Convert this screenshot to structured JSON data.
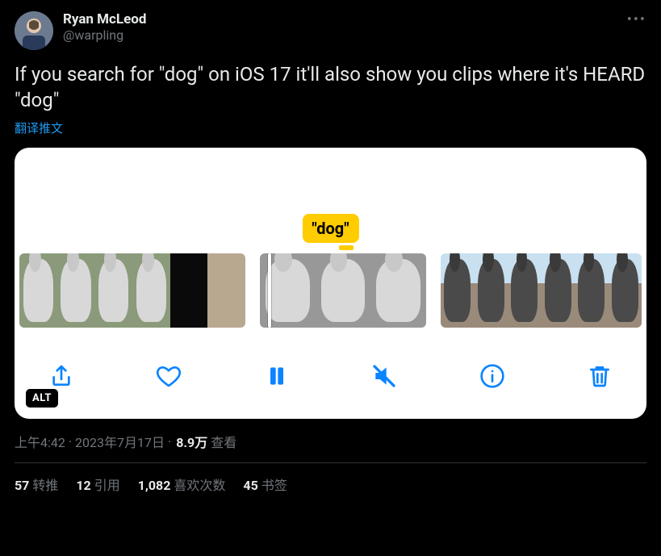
{
  "author": {
    "display_name": "Ryan McLeod",
    "handle": "@warpling"
  },
  "more_icon": "more-horizontal-icon",
  "body": "If you search for \"dog\" on iOS 17 it'll also show you clips where it's HEARD \"dog\"",
  "translate_label": "翻译推文",
  "media": {
    "search_token": "\"dog\"",
    "alt_badge": "ALT",
    "toolbar_icons": {
      "share": "share-icon",
      "like": "heart-icon",
      "pause": "pause-icon",
      "mute": "speaker-muted-icon",
      "info": "info-icon",
      "delete": "trash-icon"
    }
  },
  "meta": {
    "time": "上午4:42",
    "date": "2023年7月17日",
    "separator": " · ",
    "views_count": "8.9万",
    "views_label": " 查看"
  },
  "stats": {
    "retweets_count": "57",
    "retweets_label": "转推",
    "quotes_count": "12",
    "quotes_label": "引用",
    "likes_count": "1,082",
    "likes_label": "喜欢次数",
    "bookmarks_count": "45",
    "bookmarks_label": "书签"
  }
}
